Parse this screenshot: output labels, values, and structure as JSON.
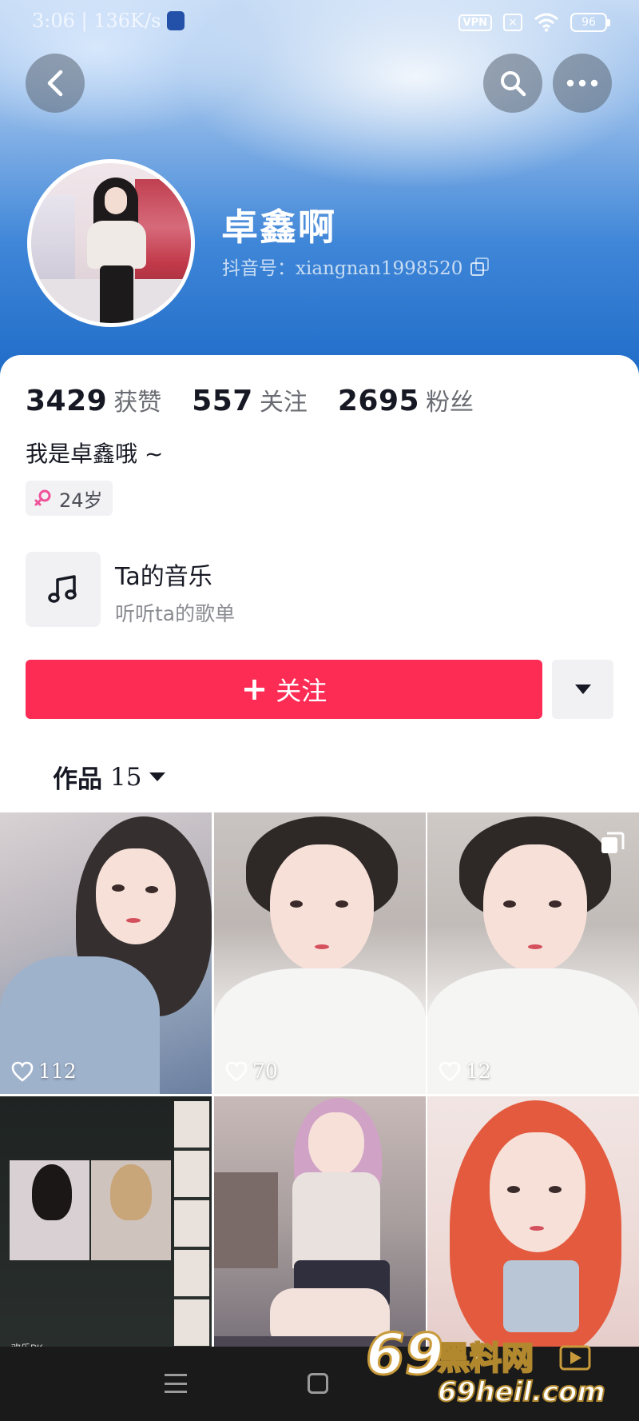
{
  "status_bar": {
    "time_speed": "3:06 | 136K/s",
    "vpn": "VPN",
    "battery": "96"
  },
  "profile": {
    "name": "卓鑫啊",
    "douyin_id": "抖音号：xiangnan1998520",
    "bio": "我是卓鑫哦 ~",
    "age_tag": "24岁"
  },
  "stats": [
    {
      "value": "3429",
      "label": "获赞"
    },
    {
      "value": "557",
      "label": "关注"
    },
    {
      "value": "2695",
      "label": "粉丝"
    }
  ],
  "music": {
    "title": "Ta的音乐",
    "subtitle": "听听ta的歌单"
  },
  "actions": {
    "follow_label": "关注"
  },
  "works": {
    "label": "作品",
    "count": "15"
  },
  "videos": [
    {
      "likes": "112"
    },
    {
      "likes": "70"
    },
    {
      "likes": "12"
    },
    {
      "overlay": "欢乐PK"
    }
  ],
  "watermark": {
    "line1": "69黑料网",
    "line2": "69heil.com"
  },
  "colors": {
    "accent": "#fd2c55",
    "text_primary": "#161823",
    "text_secondary": "#8a8b91",
    "header_blue": "#3f86d8"
  }
}
